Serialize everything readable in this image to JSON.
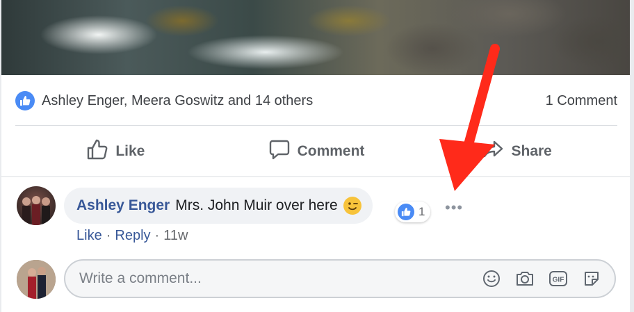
{
  "post": {
    "likes_summary": "Ashley Enger, Meera Goswitz and 14 others",
    "comments_count": "1 Comment"
  },
  "actions": {
    "like_label": "Like",
    "comment_label": "Comment",
    "share_label": "Share"
  },
  "comment": {
    "author": "Ashley Enger",
    "text": "Mrs. John Muir over here",
    "reaction_count": "1",
    "like_link": "Like",
    "separator": "·",
    "reply_link": "Reply",
    "time": "11w"
  },
  "composer": {
    "placeholder": "Write a comment..."
  },
  "icons": {
    "like_badge": "thumbs-up-icon",
    "like_action": "thumbs-up-outline-icon",
    "comment_action": "speech-bubble-icon",
    "share_action": "share-arrow-icon",
    "emoji": "wink-emoji-icon",
    "more": "more-dots-icon",
    "input_emoji": "smiley-icon",
    "input_camera": "camera-icon",
    "input_gif": "gif-icon",
    "input_sticker": "sticker-icon"
  },
  "colors": {
    "accent": "#4a8bf5",
    "link": "#385898",
    "annotation_arrow": "#ff2a1a"
  }
}
